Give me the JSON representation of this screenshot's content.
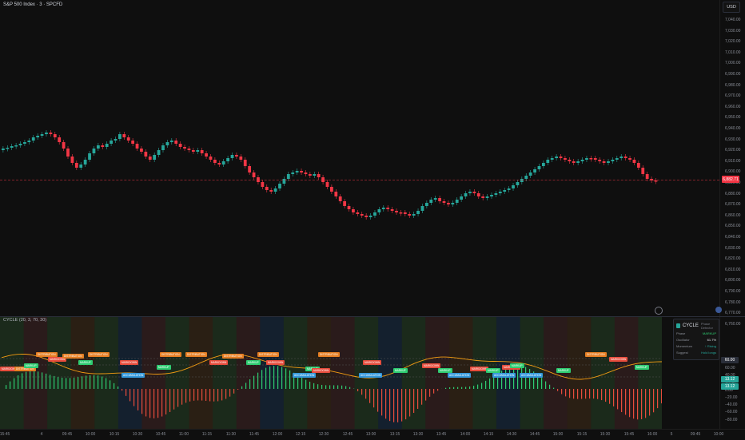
{
  "header": {
    "symbol": "S&P 500 Index · 3 · SPCFD",
    "currency": "USD"
  },
  "price_axis": {
    "ticks": [
      "7,040.00",
      "7,030.00",
      "7,020.00",
      "7,010.00",
      "7,000.00",
      "6,990.00",
      "6,980.00",
      "6,970.00",
      "6,960.00",
      "6,950.00",
      "6,940.00",
      "6,930.00",
      "6,920.00",
      "6,910.00",
      "6,900.00",
      "6,890.00",
      "6,880.00",
      "6,870.00",
      "6,860.00",
      "6,850.00",
      "6,840.00",
      "6,830.00",
      "6,820.00",
      "6,810.00",
      "6,800.00",
      "6,790.00",
      "6,780.00",
      "6,770.00",
      "6,760.00"
    ],
    "current_price": "6,882.71",
    "current_color": "#f23645"
  },
  "indicator": {
    "title": "CYCLE (20, 3, 70, 30)",
    "ticks": [
      "80.00",
      "60.00",
      "40.00",
      "20.00",
      "0.00",
      "−20.00",
      "−40.00",
      "−60.00",
      "−80.00"
    ],
    "tag_top": "60.00",
    "tag_mid": "13.12",
    "tag_low": "13.12"
  },
  "cycle_panel": {
    "title": "CYCLE",
    "subtitle": "Phase Detector",
    "rows": [
      {
        "label": "Phase",
        "value": "MARKUP"
      },
      {
        "label": "Oscillator",
        "value": "61.7%"
      },
      {
        "label": "Momentum",
        "value": "↑ Rising"
      },
      {
        "label": "Suggest",
        "value": "Hold longs"
      }
    ]
  },
  "phase_labels": {
    "distribution": "DISTRIBUTION",
    "markdown": "MARKDOWN",
    "markup": "MARKUP",
    "accumulation": "ACCUMULATION"
  },
  "time_axis": {
    "ticks": [
      "15:45",
      "4",
      "09:45",
      "10:00",
      "10:15",
      "10:30",
      "10:45",
      "11:00",
      "11:15",
      "11:30",
      "11:45",
      "12:00",
      "12:15",
      "12:30",
      "12:45",
      "13:00",
      "13:15",
      "13:30",
      "13:45",
      "14:00",
      "14:15",
      "14:30",
      "14:45",
      "15:00",
      "15:15",
      "15:30",
      "15:45",
      "16:00",
      "5",
      "09:45",
      "10:00"
    ]
  },
  "colors": {
    "bull": "#26a69a",
    "bear": "#f23645",
    "background": "#0f0f0f"
  }
}
